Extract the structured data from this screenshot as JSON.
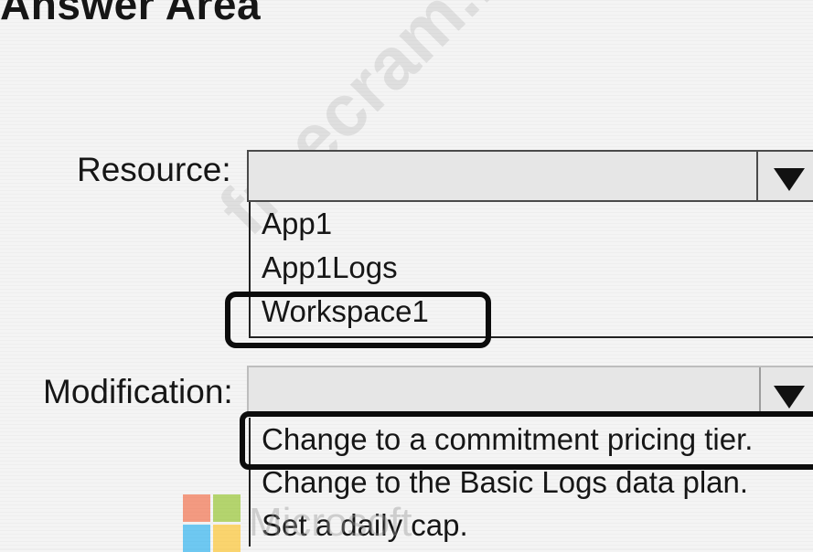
{
  "heading": "Answer Area",
  "resource": {
    "label": "Resource:",
    "options": [
      "App1",
      "App1Logs",
      "Workspace1"
    ],
    "selected": "Workspace1"
  },
  "modification": {
    "label": "Modification:",
    "options": [
      "Change to a commitment pricing tier.",
      "Change to the Basic Logs data plan.",
      "Set a daily cap."
    ],
    "selected": "Change to a commitment pricing tier."
  },
  "watermark": {
    "text": "freecram.net",
    "logo_word": "Microsoft"
  }
}
